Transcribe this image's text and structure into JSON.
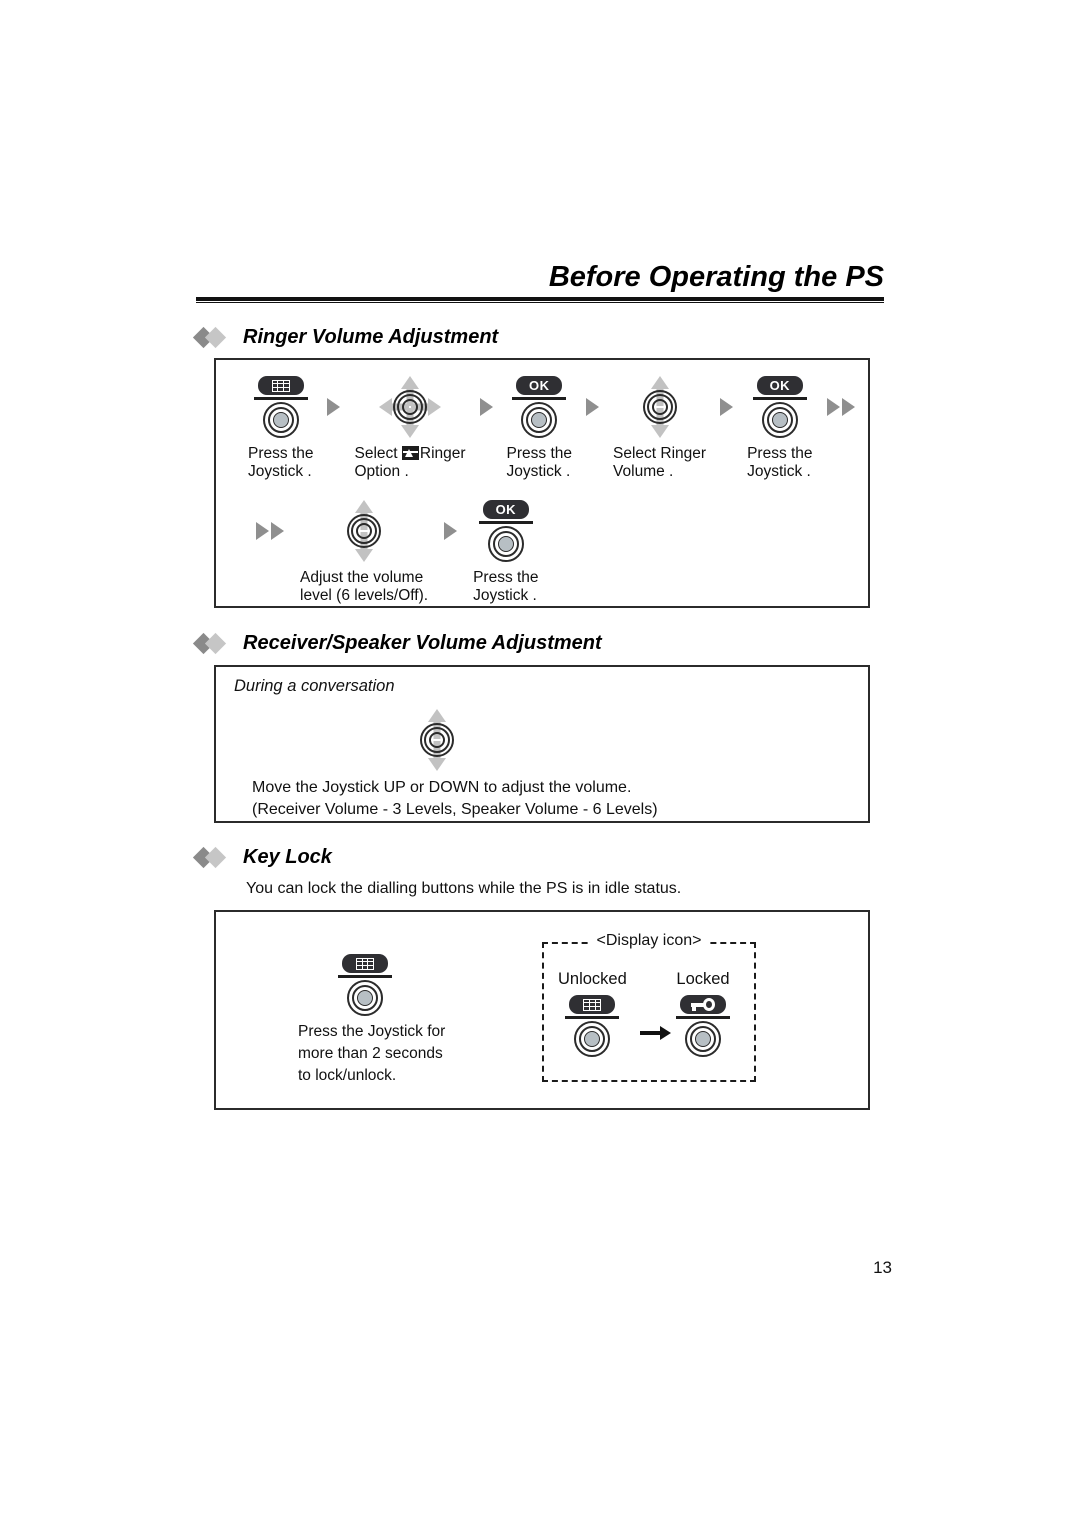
{
  "header": {
    "title": "Before Operating the PS"
  },
  "sections": [
    {
      "id": "ringer-volume",
      "title": "Ringer Volume Adjustment",
      "steps_row1": [
        {
          "icon": "joystick-keypad-icon",
          "caption_line1": "Press the",
          "caption_line2": "Joystick ."
        },
        {
          "icon": "joystick-4way-icon",
          "caption_line1": "Select  Ringer",
          "caption_line2": "Option  ."
        },
        {
          "icon": "joystick-ok-icon",
          "caption_line1": "Press the",
          "caption_line2": "Joystick ."
        },
        {
          "icon": "joystick-updown-icon",
          "caption_line1": "Select  Ringer",
          "caption_line2": "Volume ."
        },
        {
          "icon": "joystick-ok-icon",
          "caption_line1": "Press the",
          "caption_line2": "Joystick ."
        }
      ],
      "steps_row2": [
        {
          "icon": "joystick-updown-icon",
          "caption_line1": "Adjust the volume",
          "caption_line2": "level (6 levels/Off)."
        },
        {
          "icon": "joystick-ok-icon",
          "caption_line1": "Press the",
          "caption_line2": "Joystick ."
        }
      ]
    },
    {
      "id": "receiver-speaker-volume",
      "title": "Receiver/Speaker Volume Adjustment",
      "note": "During a conversation",
      "body_line1": "Move the Joystick UP   or DOWN to adjust the volume.",
      "body_line2": "(Receiver Volume - 3 Levels, Speaker Volume - 6 Levels)"
    },
    {
      "id": "key-lock",
      "title": "Key Lock",
      "intro": "You can lock the dialling buttons while the PS is in idle status.",
      "instruction_line1": "Press the Joystick   for",
      "instruction_line2": "more than 2 seconds",
      "instruction_line3": "to lock/unlock.",
      "display_icon_label": "<Display icon>",
      "unlocked_label": "Unlocked",
      "locked_label": "Locked"
    }
  ],
  "footer": {
    "page_number": "13"
  },
  "colors": {
    "ink": "#111111",
    "arrow_gray": "#8f8f8f",
    "icon_gray": "#c2c2c2",
    "cap_dark": "#2f2f33",
    "hub_fill": "#b7bfc4",
    "diamond_dark": "#8a8a8a",
    "diamond_light": "#c6c6c6"
  }
}
